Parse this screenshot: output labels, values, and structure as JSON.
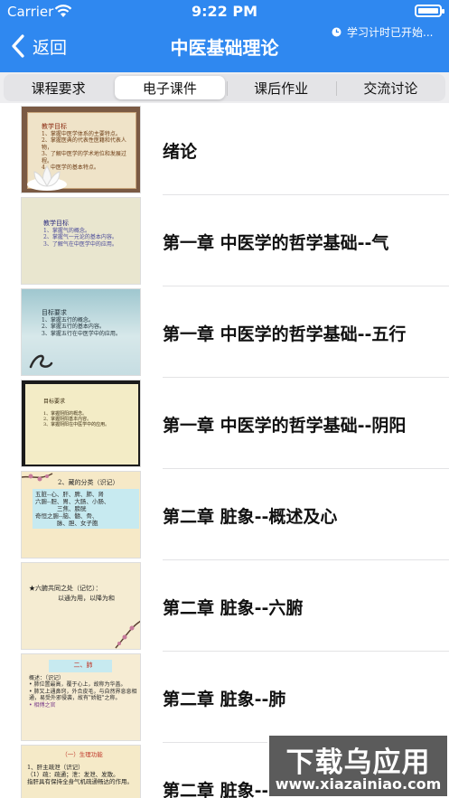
{
  "status_bar": {
    "carrier": "Carrier",
    "time": "9:22 PM"
  },
  "nav": {
    "back_label": "返回",
    "title": "中医基础理论",
    "study_timer": "学习计时已开始..."
  },
  "tabs": [
    {
      "label": "课程要求",
      "active": false
    },
    {
      "label": "电子课件",
      "active": true
    },
    {
      "label": "课后作业",
      "active": false
    },
    {
      "label": "交流讨论",
      "active": false
    }
  ],
  "courseware": [
    {
      "title": "绪论",
      "thumb": {
        "heading": "教学目标",
        "lines": [
          "1、掌握中医学体系的主要特点。",
          "2、掌握医典的代表性医籍和代表人物，",
          "3、了解中医学的学术地位和发展过程。",
          "4、中医学的基本特点。"
        ]
      }
    },
    {
      "title": "第一章 中医学的哲学基础--气",
      "thumb": {
        "heading": "教学目标",
        "lines": [
          "1、掌握气的概念。",
          "2、掌握气一元论的基本内容。",
          "3、了解气在中医学中的应用。"
        ]
      }
    },
    {
      "title": "第一章 中医学的哲学基础--五行",
      "thumb": {
        "heading": "目标要求",
        "lines": [
          "1、掌握五行的概念。",
          "2、掌握五行的基本内容。",
          "3、掌握五行在中医学中的应用。"
        ]
      }
    },
    {
      "title": "第一章 中医学的哲学基础--阴阳",
      "thumb": {
        "heading": "目标要求",
        "lines": [
          "1、掌握阴阳的概念。",
          "2、掌握阴阳基本内容。",
          "3、掌握阴阳在中医学中的应用。"
        ]
      }
    },
    {
      "title": "第二章 脏象--概述及心",
      "thumb": {
        "heading": "2、藏的分类（识记）",
        "lines": [
          "五脏--心、肝、脾、肺、肾",
          "六腑--胆、胃、大肠、小肠、",
          "三焦、膀胱",
          "奇恒之腑--脑、髓、骨、",
          "脉、胆、女子胞"
        ]
      }
    },
    {
      "title": "第二章 脏象--六腑",
      "thumb": {
        "heading": "★六腑共同之处（记忆）：",
        "lines": [
          "以通为用，以降为和"
        ]
      }
    },
    {
      "title": "第二章 脏象--肺",
      "thumb": {
        "heading": "二、肺",
        "lines": [
          "概述：（识记）",
          "• 肺位置最高，覆于心上，故称为华盖。",
          "• 肺又上通鼻窍，外合皮毛，与自然界息息相通，易受外邪侵袭，故有\"娇脏\"之称。",
          "• 相傅之官"
        ]
      }
    },
    {
      "title": "第二章 脏象--肝",
      "thumb": {
        "heading": "（一）生理功能",
        "lines": [
          "1、肝主疏泄（识记）",
          "（1）疏：疏通；泄：发泄、发散。",
          "指肝具有保持全身气机疏通畅达的作用。"
        ]
      }
    }
  ],
  "watermark": {
    "title": "下载乌应用",
    "url": "www.xiazainiao.com"
  }
}
